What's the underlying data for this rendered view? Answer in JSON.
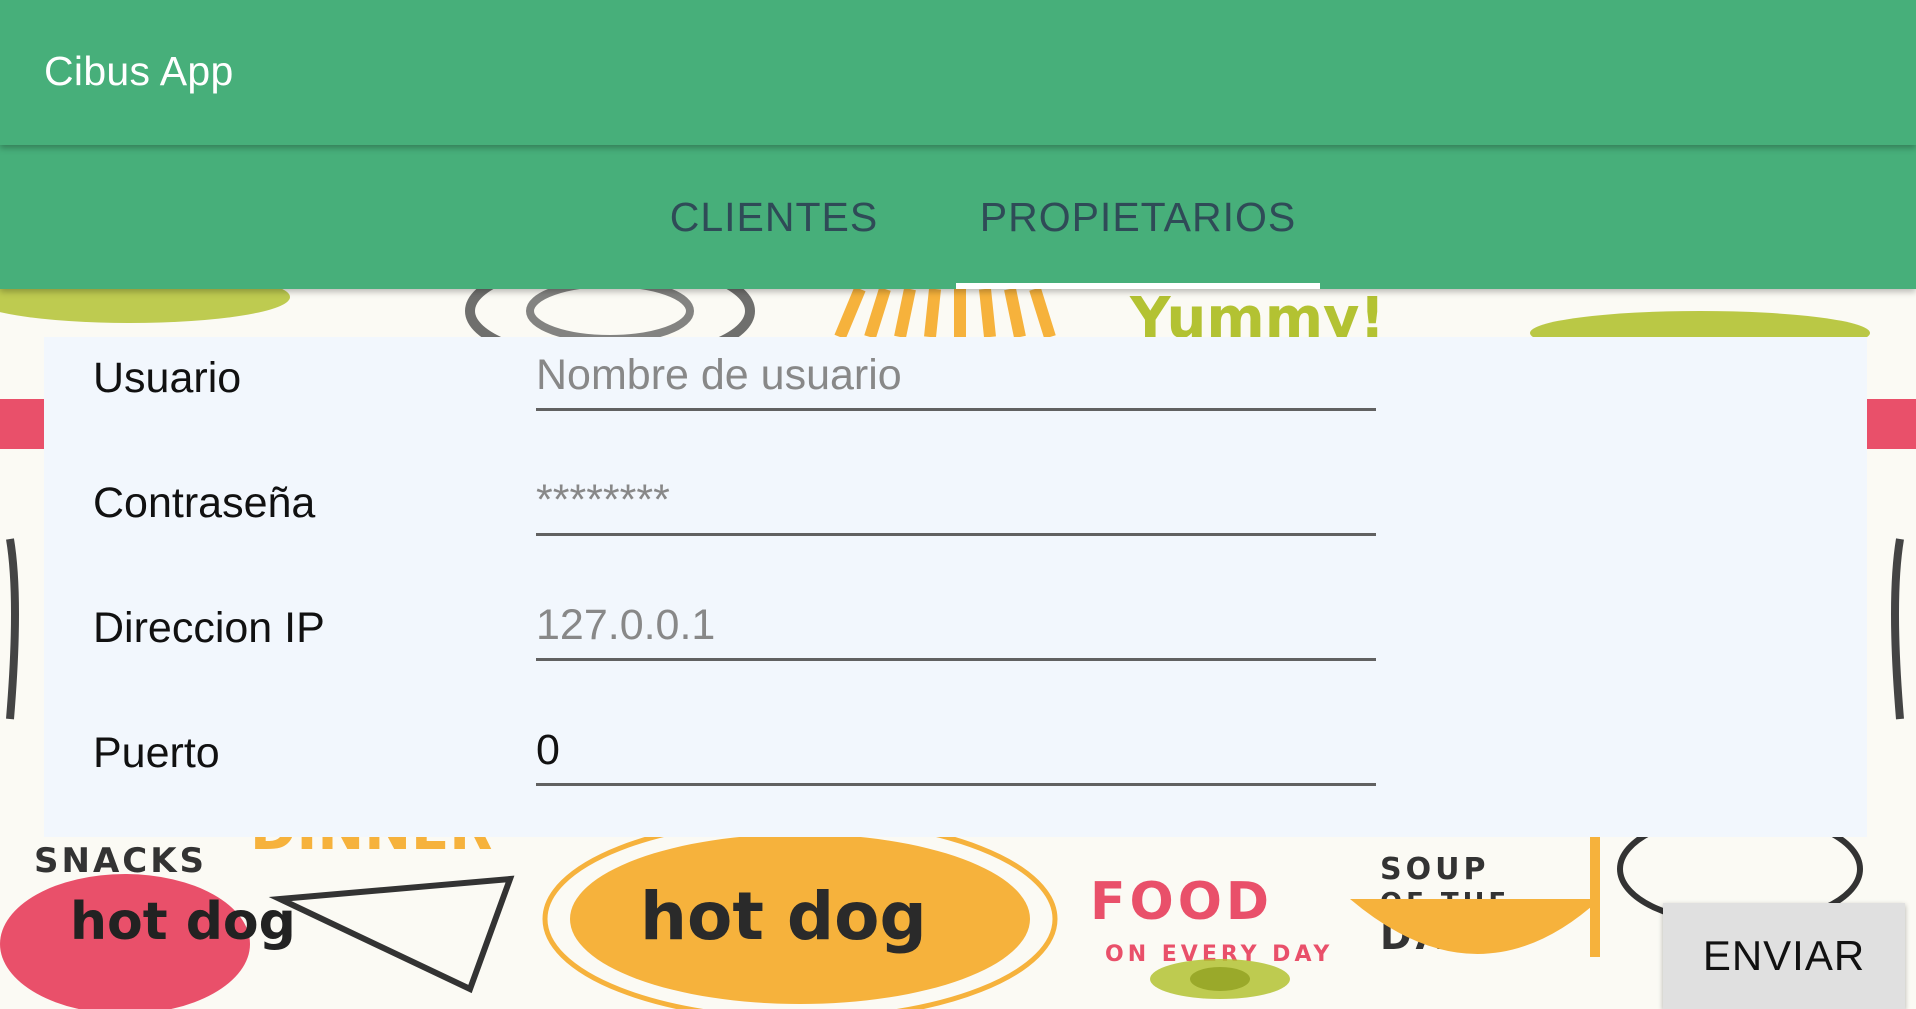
{
  "app_bar": {
    "title": "Cibus App"
  },
  "tabs": [
    {
      "label": "CLIENTES",
      "selected": false
    },
    {
      "label": "PROPIETARIOS",
      "selected": true
    }
  ],
  "form": {
    "username": {
      "label": "Usuario",
      "placeholder": "Nombre de usuario",
      "value": ""
    },
    "password": {
      "label": "Contraseña",
      "placeholder": "********",
      "value": ""
    },
    "ip": {
      "label": "Direccion IP",
      "placeholder": "127.0.0.1",
      "value": ""
    },
    "port": {
      "label": "Puerto",
      "value": "0"
    }
  },
  "actions": {
    "send_label": "ENVIAR"
  },
  "background": {
    "texts": [
      "Yummy!",
      "SNACKS",
      "DINNER",
      "hot dog",
      "hot dog",
      "FOOD",
      "ON EVERY DAY",
      "SOUP",
      "OF THE",
      "DAY"
    ]
  },
  "colors": {
    "primary": "#47af7a",
    "tab_text": "#2f4b57",
    "panel": "#f2f7fd",
    "button": "#e0e0e0",
    "accent_yellow": "#f6b23c",
    "accent_pink": "#e9506a",
    "accent_green": "#b3c232"
  }
}
